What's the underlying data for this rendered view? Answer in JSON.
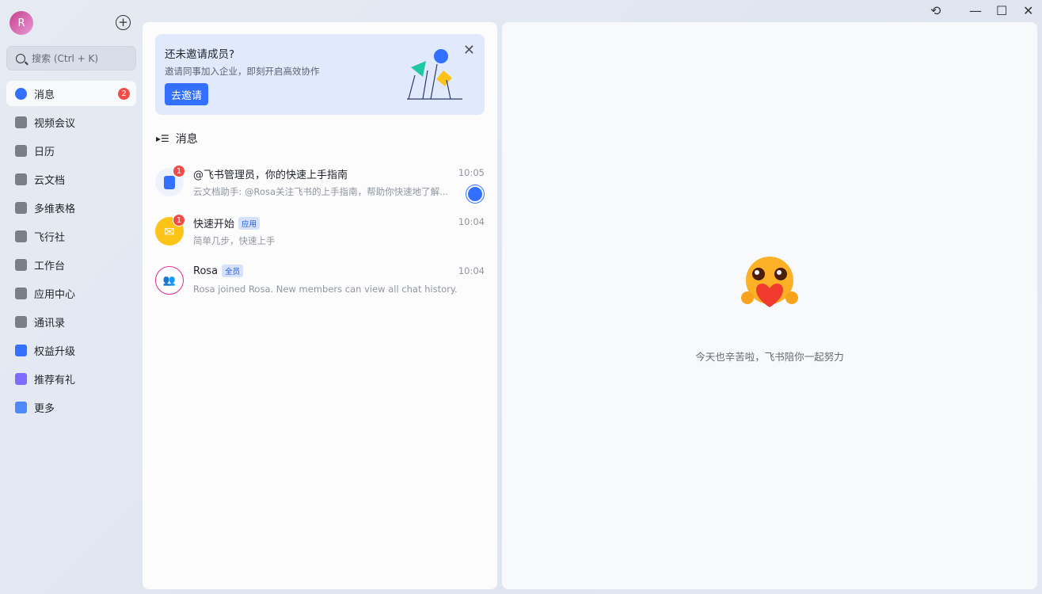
{
  "user": {
    "avatar_letter": "R"
  },
  "search": {
    "placeholder": "搜索 (Ctrl + K)"
  },
  "nav": [
    {
      "label": "消息",
      "icon": "chat-icon",
      "badge": "2",
      "active": true
    },
    {
      "label": "视频会议",
      "icon": "video-icon"
    },
    {
      "label": "日历",
      "icon": "calendar-icon"
    },
    {
      "label": "云文档",
      "icon": "docs-icon"
    },
    {
      "label": "多维表格",
      "icon": "base-icon"
    },
    {
      "label": "飞行社",
      "icon": "community-icon"
    },
    {
      "label": "工作台",
      "icon": "workplace-icon"
    },
    {
      "label": "应用中心",
      "icon": "app-center-icon"
    },
    {
      "label": "通讯录",
      "icon": "contacts-icon"
    },
    {
      "label": "权益升级",
      "icon": "upgrade-icon"
    },
    {
      "label": "推荐有礼",
      "icon": "referral-icon"
    },
    {
      "label": "更多",
      "icon": "more-icon"
    }
  ],
  "banner": {
    "title": "还未邀请成员?",
    "subtitle": "邀请同事加入企业，即刻开启高效协作",
    "button": "去邀请"
  },
  "messages_header": "消息",
  "messages": [
    {
      "title": "@飞书管理员，你的快速上手指南",
      "time": "10:05",
      "preview": "云文档助手: @Rosa关注飞书的上手指南，帮助你快速地了解...",
      "unread": "1",
      "tag": ""
    },
    {
      "title": "快速开始",
      "time": "10:04",
      "preview": "简单几步，快速上手",
      "unread": "1",
      "tag": "应用"
    },
    {
      "title": "Rosa",
      "time": "10:04",
      "preview": "Rosa joined Rosa. New members can view all chat history.",
      "unread": "",
      "tag": "全员"
    }
  ],
  "empty_state": {
    "text": "今天也辛苦啦，飞书陪你一起努力"
  },
  "colors": {
    "accent": "#3370ff",
    "badge": "#f54a45"
  }
}
